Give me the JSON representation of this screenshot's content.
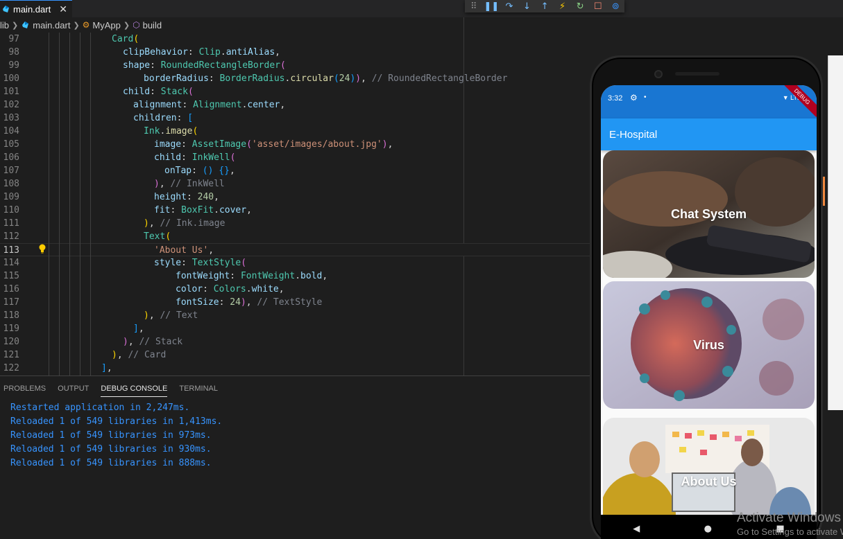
{
  "tab": {
    "filename": "main.dart",
    "close": "✕"
  },
  "breadcrumb": {
    "items": [
      "lib",
      "main.dart",
      "MyApp",
      "build"
    ]
  },
  "editor": {
    "lines": [
      {
        "n": "97"
      },
      {
        "n": "98"
      },
      {
        "n": "99"
      },
      {
        "n": "100"
      },
      {
        "n": "101"
      },
      {
        "n": "102"
      },
      {
        "n": "103"
      },
      {
        "n": "104"
      },
      {
        "n": "105"
      },
      {
        "n": "106"
      },
      {
        "n": "107"
      },
      {
        "n": "108"
      },
      {
        "n": "109"
      },
      {
        "n": "110"
      },
      {
        "n": "111"
      },
      {
        "n": "112"
      },
      {
        "n": "113"
      },
      {
        "n": "114"
      },
      {
        "n": "115"
      },
      {
        "n": "116"
      },
      {
        "n": "117"
      },
      {
        "n": "118"
      },
      {
        "n": "119"
      },
      {
        "n": "120"
      },
      {
        "n": "121"
      },
      {
        "n": "122"
      }
    ],
    "active_line": "113"
  },
  "code": {
    "l97": "Card",
    "l98a": "clipBehavior",
    "l98b": "Clip",
    "l98c": "antiAlias",
    "l99a": "shape",
    "l99b": "RoundedRectangleBorder",
    "l100a": "borderRadius",
    "l100b": "BorderRadius",
    "l100c": "circular",
    "l100d": "24",
    "l100e": "// RoundedRectangleBorder",
    "l101a": "child",
    "l101b": "Stack",
    "l102a": "alignment",
    "l102b": "Alignment",
    "l102c": "center",
    "l103a": "children",
    "l104a": "Ink",
    "l104b": "image",
    "l105a": "image",
    "l105b": "AssetImage",
    "l105c": "'asset/images/about.jpg'",
    "l106a": "child",
    "l106b": "InkWell",
    "l107a": "onTap",
    "l108a": "// InkWell",
    "l109a": "height",
    "l109b": "240",
    "l110a": "fit",
    "l110b": "BoxFit",
    "l110c": "cover",
    "l111a": "// Ink.image",
    "l112a": "Text",
    "l113a": "'About Us'",
    "l114a": "style",
    "l114b": "TextStyle",
    "l115a": "fontWeight",
    "l115b": "FontWeight",
    "l115c": "bold",
    "l116a": "color",
    "l116b": "Colors",
    "l116c": "white",
    "l117a": "fontSize",
    "l117b": "24",
    "l117c": "// TextStyle",
    "l118a": "// Text",
    "l120a": "// Stack",
    "l121a": "// Card"
  },
  "panel": {
    "tabs": [
      "PROBLEMS",
      "OUTPUT",
      "DEBUG CONSOLE",
      "TERMINAL"
    ],
    "active_tab": "DEBUG CONSOLE",
    "console_lines": [
      "Restarted application in 2,247ms.",
      "Reloaded 1 of 549 libraries in 1,413ms.",
      "Reloaded 1 of 549 libraries in 973ms.",
      "Reloaded 1 of 549 libraries in 930ms.",
      "Reloaded 1 of 549 libraries in 888ms."
    ]
  },
  "phone": {
    "status_time": "3:32",
    "status_network": "LTE",
    "debug_banner": "DEBUG",
    "app_title": "E-Hospital",
    "cards": [
      {
        "label": "Chat System"
      },
      {
        "label": "Virus"
      },
      {
        "label": "About Us"
      }
    ],
    "nav": {
      "back": "◀",
      "home": "●",
      "recents": "■"
    }
  },
  "watermark": {
    "line1": "Activate Windows",
    "line2": "Go to Settings to activate Windows."
  },
  "colors": {
    "editor_bg": "#1e1e1e",
    "appbar": "#2196f3",
    "statusbar": "#1976d2",
    "console_text": "#3794ff"
  }
}
